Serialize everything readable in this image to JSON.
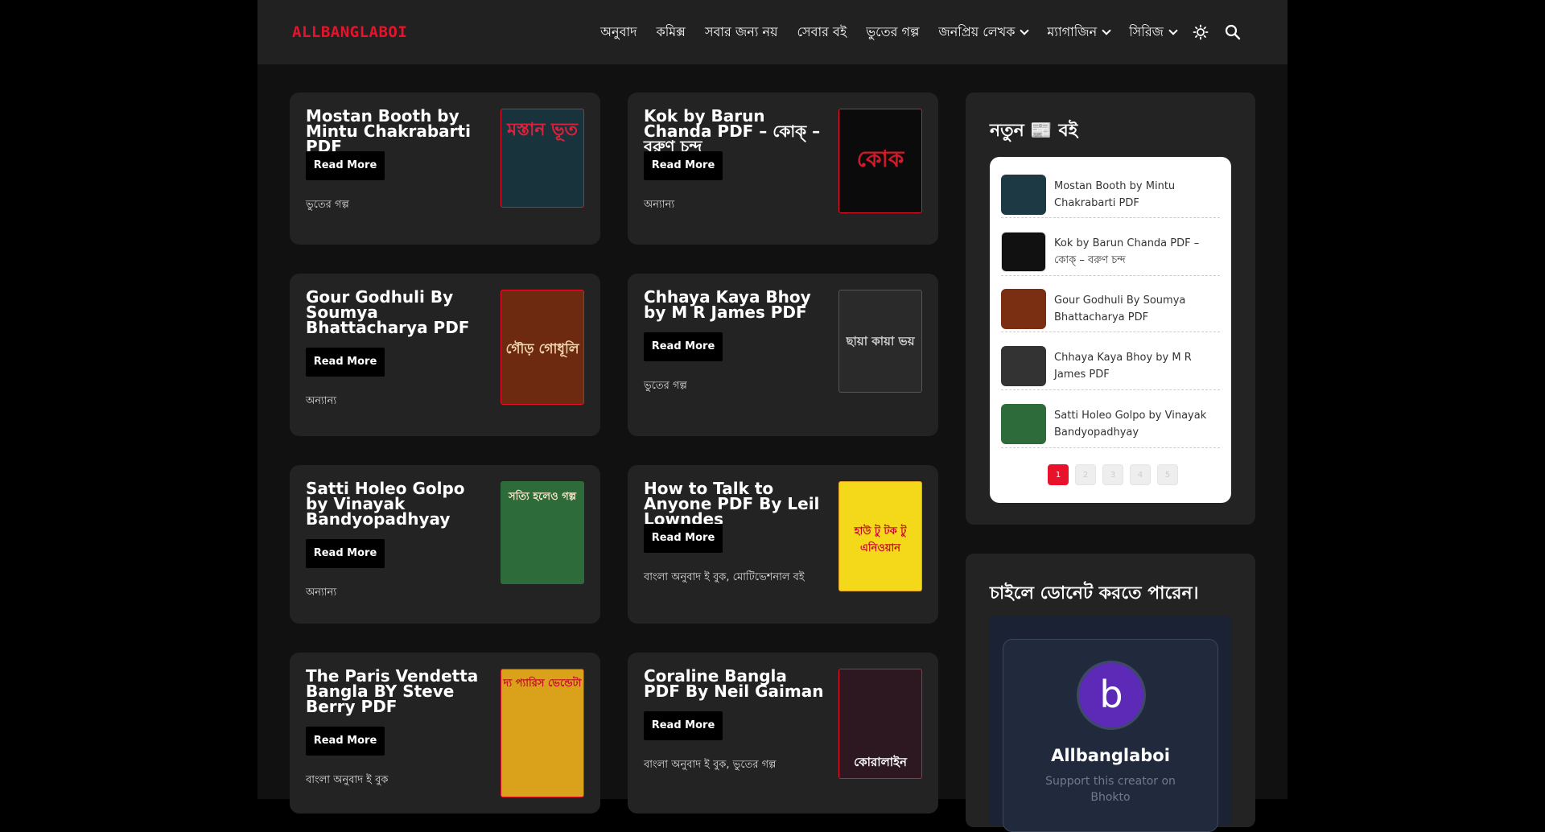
{
  "header": {
    "logo": "ALLBANGLABOI",
    "nav": [
      {
        "label": "অনুবাদ"
      },
      {
        "label": "কমিক্স"
      },
      {
        "label": "সবার জন্য নয়"
      },
      {
        "label": "সেবার বই"
      },
      {
        "label": "ভুতের গল্প"
      },
      {
        "label": "জনপ্রিয় লেখক",
        "dropdown": true
      },
      {
        "label": "ম্যাগাজিন",
        "dropdown": true
      },
      {
        "label": "সিরিজ",
        "dropdown": true
      }
    ],
    "icons": [
      "sun-icon",
      "search-icon"
    ]
  },
  "posts": [
    {
      "title": "Mostan Booth by Mintu Chakrabarti PDF",
      "button": "Read More",
      "category": "ভুতের গল্প",
      "cover": {
        "text": "মস্তান ভূত",
        "color": "#18333b",
        "accent": "#e0203b"
      }
    },
    {
      "title": "Kok by Barun Chanda PDF – কোক্ – বরুণ চন্দ",
      "button": "Read More",
      "category": "অন্যান্য",
      "cover": {
        "text": "কোক",
        "color": "#0b0b0b",
        "accent": "#d21a2a"
      }
    },
    {
      "title": "Gour Godhuli By Soumya Bhattacharya PDF",
      "button": "Read More",
      "category": "অন্যান্য",
      "cover": {
        "text": "গৌড় গোধূলি",
        "color": "#6e2a10",
        "accent": "#f2d7b0"
      }
    },
    {
      "title": "Chhaya Kaya Bhoy by M R James PDF",
      "button": "Read More",
      "category": "ভুতের গল্প",
      "cover": {
        "text": "ছায়া কায়া ভয়",
        "color": "#2a2a2a",
        "accent": "#d0d0d0"
      }
    },
    {
      "title": "Satti Holeo Golpo by Vinayak Bandyopadhyay",
      "button": "Read More",
      "category": "অন্যান্য",
      "cover": {
        "text": "সত্যি হলেও গল্প",
        "color": "#2e6b3a",
        "accent": "#c33a4a"
      }
    },
    {
      "title": "How to Talk to Anyone PDF By Leil Lowndes",
      "button": "Read More",
      "category": "বাংলা অনুবাদ ই বুক, মোটিভেশনাল বই",
      "cover": {
        "text": "হাউ টু টক টু এনিওয়ান",
        "color": "#f4d81a",
        "accent": "#c8102e"
      }
    },
    {
      "title": "The Paris Vendetta Bangla BY Steve Berry PDF",
      "button": "Read More",
      "category": "বাংলা অনুবাদ ই বুক",
      "cover": {
        "text": "দ্য প্যারিস ভেন্ডেটা",
        "color": "#d9a21a",
        "accent": "#c8102e"
      }
    },
    {
      "title": "Coraline Bangla PDF By Neil Gaiman",
      "button": "Read More",
      "category": "বাংলা অনুবাদ ই বুক, ভুতের গল্প",
      "cover": {
        "text": "কোরালাইন",
        "color": "#2d1720",
        "accent": "#d83040"
      }
    }
  ],
  "sidebar": {
    "recent_title": "নতুন 📰 বই",
    "recent": [
      {
        "label": "Mostan Booth by Mintu Chakrabarti PDF",
        "thumb": "#1d3a44"
      },
      {
        "label": "Kok by Barun Chanda PDF – কোক্ – বরুণ চন্দ",
        "thumb": "#111111"
      },
      {
        "label": "Gour Godhuli By Soumya Bhattacharya PDF",
        "thumb": "#7a2e12"
      },
      {
        "label": "Chhaya Kaya Bhoy by M R James PDF",
        "thumb": "#333333"
      },
      {
        "label": "Satti Holeo Golpo by Vinayak Bandyopadhyay",
        "thumb": "#2e6b3a"
      }
    ],
    "pages": [
      "1",
      "2",
      "3",
      "4",
      "5"
    ],
    "active_page": "1",
    "donate_title": "চাইলে ডোনেট করতে পারেন।",
    "donate": {
      "avatar_letter": "b",
      "name": "Allbanglaboi",
      "subtitle": "Support this creator on Bhokto"
    }
  }
}
